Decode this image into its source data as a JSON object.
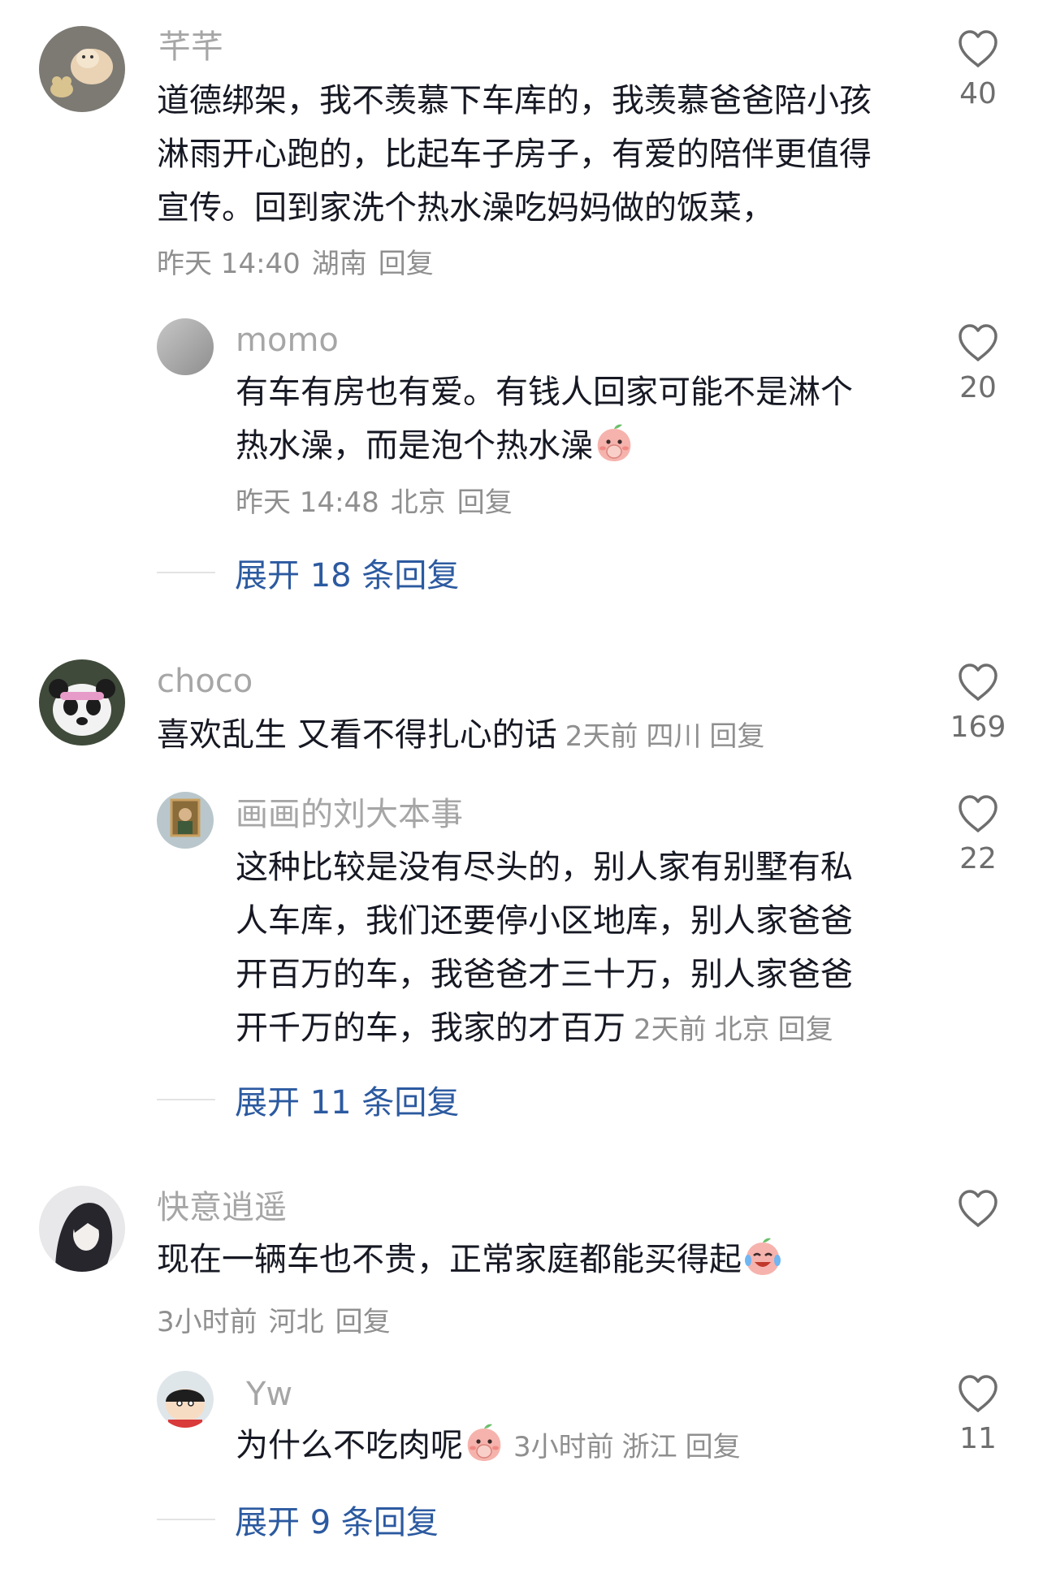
{
  "comments": [
    {
      "username": "芊芊",
      "lines": [
        "道德绑架，我不羡慕下车库的，我羡慕爸爸陪小孩",
        "淋雨开心跑的，比起车子房子，有爱的陪伴更值得",
        "宣传。回到家洗个热水澡吃妈妈做的饭菜，"
      ],
      "time": "昨天 14:40",
      "location": "湖南",
      "reply_label": "回复",
      "likes": "40"
    },
    {
      "username": "momo",
      "lines": [
        "有车有房也有爱。有钱人回家可能不是淋个",
        "热水澡，而是泡个热水澡"
      ],
      "time": "昨天 14:48",
      "location": "北京",
      "reply_label": "回复",
      "likes": "20",
      "expand": "展开 18 条回复"
    },
    {
      "username": "choco",
      "lines": [
        "喜欢乱生  又看不得扎心的话"
      ],
      "time": "2天前",
      "location": "四川",
      "reply_label": "回复",
      "likes": "169"
    },
    {
      "username": "画画的刘大本事",
      "lines": [
        "这种比较是没有尽头的，别人家有别墅有私",
        "人车库，我们还要停小区地库，别人家爸爸",
        "开百万的车，我爸爸才三十万，别人家爸爸",
        "开千万的车，我家的才百万"
      ],
      "time": "2天前",
      "location": "北京",
      "reply_label": "回复",
      "likes": "22",
      "expand": "展开 11 条回复"
    },
    {
      "username": "快意逍遥",
      "lines": [
        "现在一辆车也不贵，正常家庭都能买得起"
      ],
      "time": "3小时前",
      "location": "河北",
      "reply_label": "回复",
      "likes": ""
    },
    {
      "username": "Yw",
      "lines": [
        "为什么不吃肉呢"
      ],
      "time": "3小时前",
      "location": "浙江",
      "reply_label": "回复",
      "likes": "11",
      "expand": "展开 9 条回复"
    }
  ],
  "icons": {
    "like": "heart-outline-icon",
    "emoji_peach_cover_mouth": "peach-cover-mouth-emoji",
    "emoji_peach_laugh_cry": "peach-laugh-cry-emoji"
  },
  "colors": {
    "text": "#161823",
    "username": "#a6a6a6",
    "meta": "#8f8f8f",
    "expand": "#2c5aa0"
  }
}
